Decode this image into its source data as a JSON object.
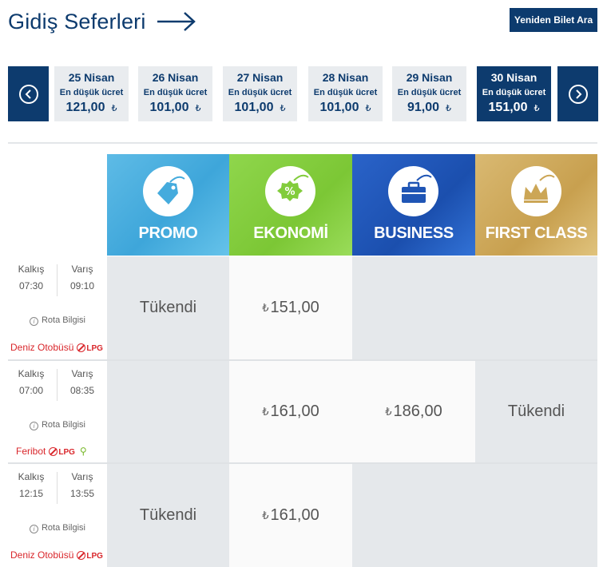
{
  "header": {
    "title": "Gidiş Seferleri",
    "reload_button": "Yeniden Bilet Ara"
  },
  "datebar": {
    "prev_icon": "chevron-left-icon",
    "next_icon": "chevron-right-icon",
    "dates": [
      {
        "date": "25 Nisan",
        "label": "En düşük ücret",
        "price": "121,00",
        "currency": "₺",
        "active": false
      },
      {
        "date": "26 Nisan",
        "label": "En düşük ücret",
        "price": "101,00",
        "currency": "₺",
        "active": false
      },
      {
        "date": "27 Nisan",
        "label": "En düşük ücret",
        "price": "101,00",
        "currency": "₺",
        "active": false
      },
      {
        "date": "28 Nisan",
        "label": "En düşük ücret",
        "price": "101,00",
        "currency": "₺",
        "active": false
      },
      {
        "date": "29 Nisan",
        "label": "En düşük ücret",
        "price": "91,00",
        "currency": "₺",
        "active": false
      },
      {
        "date": "30 Nisan",
        "label": "En düşük ücret",
        "price": "151,00",
        "currency": "₺",
        "active": true
      }
    ]
  },
  "classes": [
    {
      "name": "PROMO",
      "icon": "tag-icon"
    },
    {
      "name": "EKONOMİ",
      "icon": "percent-badge-icon"
    },
    {
      "name": "BUSINESS",
      "icon": "briefcase-icon"
    },
    {
      "name": "FIRST CLASS",
      "icon": "crown-icon"
    }
  ],
  "labels": {
    "departure": "Kalkış",
    "arrival": "Varış",
    "route_info": "Rota Bilgisi",
    "lpg": "LPG",
    "currency": "₺"
  },
  "trips": [
    {
      "departure": "07:30",
      "arrival": "09:10",
      "vessel": "Deniz Otobüsü",
      "bike": false,
      "cells": [
        "Tükendi",
        "151,00",
        "",
        ""
      ]
    },
    {
      "departure": "07:00",
      "arrival": "08:35",
      "vessel": "Feribot",
      "bike": true,
      "cells": [
        "",
        "161,00",
        "186,00",
        "Tükendi"
      ]
    },
    {
      "departure": "12:15",
      "arrival": "13:55",
      "vessel": "Deniz Otobüsü",
      "bike": false,
      "cells": [
        "Tükendi",
        "161,00",
        "",
        ""
      ]
    }
  ],
  "colors": {
    "primary": "#0d3b6e",
    "promo": "#45abdd",
    "ekonomi": "#82cc3c",
    "business": "#1f55b5",
    "first_class": "#cca656",
    "vessel_red": "#d9262b"
  }
}
